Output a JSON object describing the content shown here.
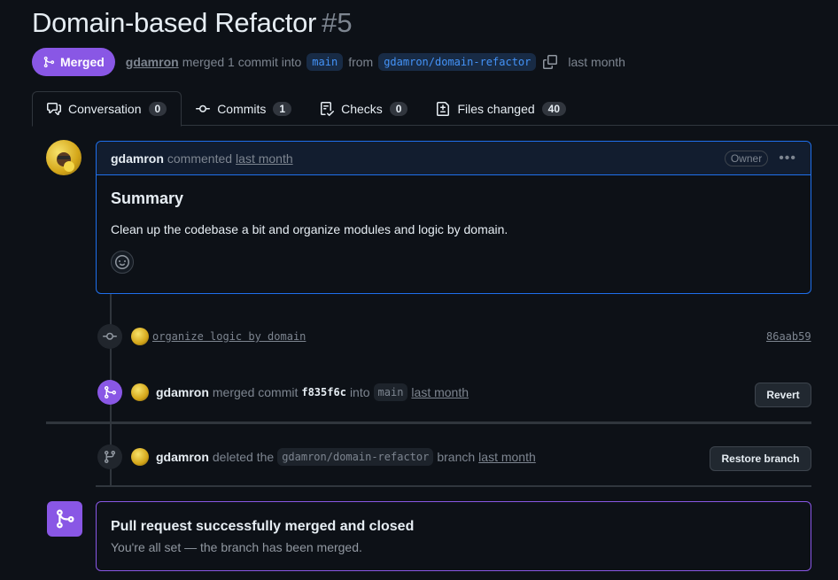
{
  "pr": {
    "title": "Domain-based Refactor",
    "number": "#5",
    "state": "Merged",
    "author": "gdamron",
    "merge_text": "merged 1 commit into",
    "base_branch": "main",
    "from_text": "from",
    "head_branch": "gdamron/domain-refactor",
    "when": "last month"
  },
  "tabs": [
    {
      "label": "Conversation",
      "count": "0",
      "icon": "conversation-icon"
    },
    {
      "label": "Commits",
      "count": "1",
      "icon": "commit-icon"
    },
    {
      "label": "Checks",
      "count": "0",
      "icon": "checklist-icon"
    },
    {
      "label": "Files changed",
      "count": "40",
      "icon": "file-diff-icon"
    }
  ],
  "comment": {
    "author": "gdamron",
    "verb": "commented",
    "time": "last month",
    "role": "Owner",
    "heading": "Summary",
    "body": "Clean up the codebase a bit and organize modules and logic by domain."
  },
  "events": {
    "commit": {
      "message": "organize logic by domain",
      "sha": "86aab59"
    },
    "merged": {
      "author": "gdamron",
      "verb": "merged commit",
      "sha": "f835f6c",
      "into": "into",
      "branch": "main",
      "time": "last month",
      "button": "Revert"
    },
    "deleted": {
      "author": "gdamron",
      "verb": "deleted the",
      "branch_name": "gdamron/domain-refactor",
      "branch_word": "branch",
      "time": "last month",
      "button": "Restore branch"
    }
  },
  "merged_box": {
    "heading": "Pull request successfully merged and closed",
    "sub": "You're all set — the branch has been merged."
  },
  "colors": {
    "merged_purple": "#8957e5",
    "link_blue": "#4493f8",
    "bg": "#0d1117"
  }
}
